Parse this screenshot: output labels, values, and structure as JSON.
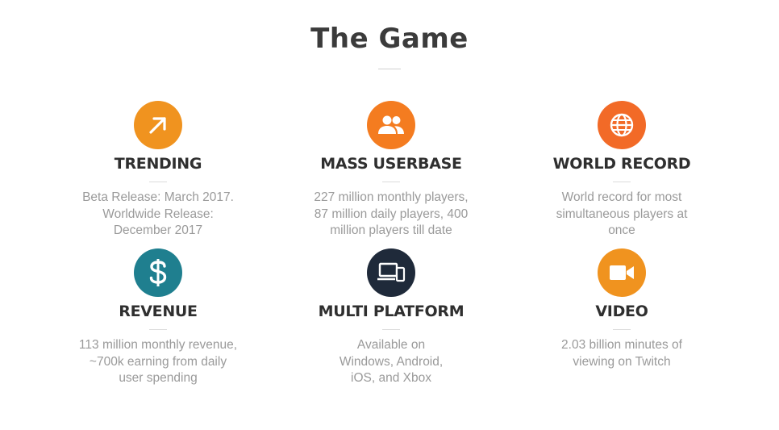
{
  "page": {
    "title": "The Game"
  },
  "features": [
    {
      "title": "TRENDING",
      "description": "Beta Release: March 2017. Worldwide Release: December 2017",
      "icon": "trending-up-arrow-icon",
      "color": "#f0931f"
    },
    {
      "title": "MASS USERBASE",
      "description": "227 million monthly players, 87 million daily players, 400 million players till date",
      "icon": "users-group-icon",
      "color": "#f47c20"
    },
    {
      "title": "WORLD RECORD",
      "description": "World record for most simultaneous players at once",
      "icon": "globe-icon",
      "color": "#f26a27"
    },
    {
      "title": "REVENUE",
      "description": "113 million monthly revenue, ~700k earning from daily user spending",
      "icon": "dollar-sign-icon",
      "color": "#1f7f8f"
    },
    {
      "title": "MULTI PLATFORM",
      "description": "Available on Windows, Android, iOS, and Xbox",
      "icon": "devices-icon",
      "color": "#1f2a3a"
    },
    {
      "title": "VIDEO",
      "description": "2.03 billion minutes of viewing on Twitch",
      "icon": "video-camera-icon",
      "color": "#f0931f"
    }
  ]
}
